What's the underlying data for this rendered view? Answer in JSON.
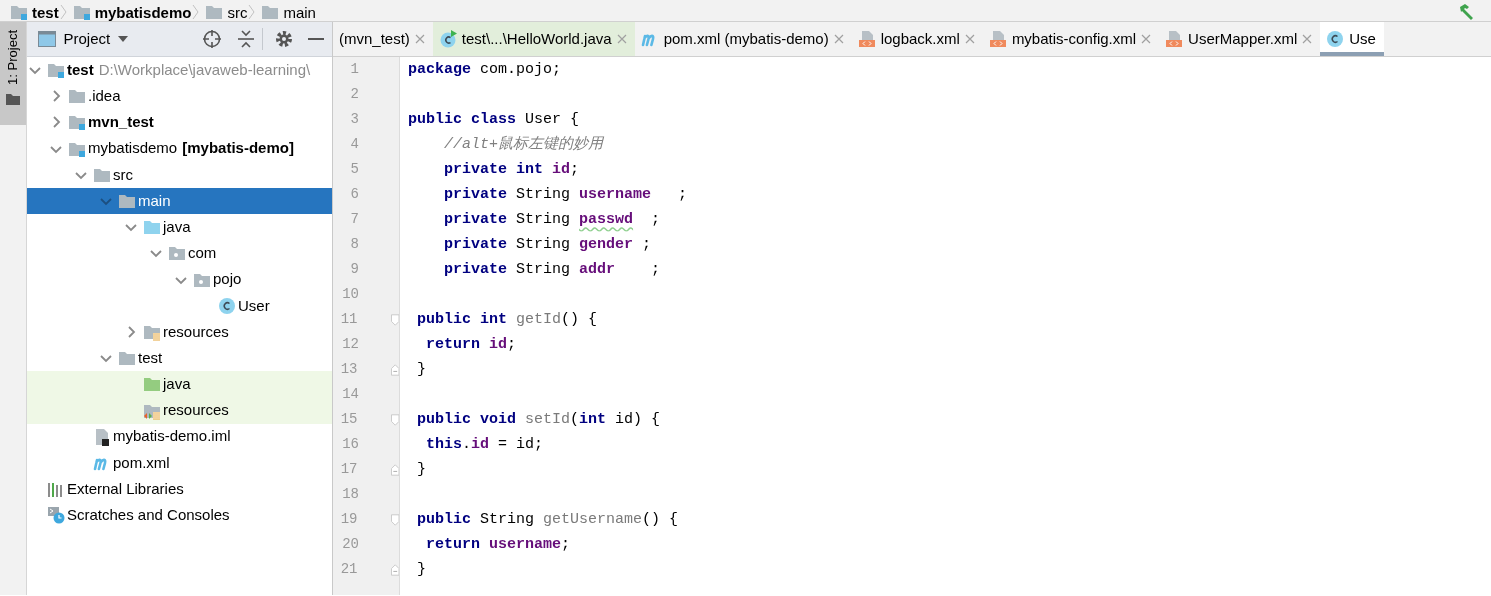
{
  "breadcrumb": [
    {
      "label": "test",
      "kind": "module",
      "bold": true
    },
    {
      "label": "mybatisdemo",
      "kind": "module",
      "bold": true
    },
    {
      "label": "src",
      "kind": "folder",
      "bold": false
    },
    {
      "label": "main",
      "kind": "folder",
      "bold": false
    }
  ],
  "side_tab": {
    "label": "1: Project",
    "selected": true
  },
  "project_panel": {
    "title": "Project"
  },
  "tree": [
    {
      "label": "test",
      "path": "D:\\Workplace\\javaweb-learning\\",
      "kind": "module",
      "bold": true,
      "selected": false,
      "expanded": true,
      "children": [
        {
          "label": ".idea",
          "kind": "folder",
          "bold": false,
          "selected": false,
          "expanded": false
        },
        {
          "label": "mvn_test",
          "kind": "module",
          "bold": true,
          "selected": false,
          "expanded": false
        },
        {
          "label": "mybatisdemo",
          "module_name": "[mybatis-demo]",
          "kind": "module",
          "bold": false,
          "selected": false,
          "expanded": true,
          "children": [
            {
              "label": "src",
              "kind": "folder",
              "bold": false,
              "selected": false,
              "expanded": true,
              "children": [
                {
                  "label": "main",
                  "kind": "folder",
                  "bold": false,
                  "selected": true,
                  "expanded": true,
                  "children": [
                    {
                      "label": "java",
                      "kind": "source",
                      "bold": false,
                      "selected": false,
                      "expanded": true,
                      "children": [
                        {
                          "label": "com",
                          "kind": "package",
                          "bold": false,
                          "selected": false,
                          "expanded": true,
                          "children": [
                            {
                              "label": "pojo",
                              "kind": "package",
                              "bold": false,
                              "selected": false,
                              "expanded": true,
                              "children": [
                                {
                                  "label": "User",
                                  "kind": "class",
                                  "bold": false,
                                  "selected": false
                                }
                              ]
                            }
                          ]
                        }
                      ]
                    },
                    {
                      "label": "resources",
                      "kind": "resources",
                      "bold": false,
                      "selected": false,
                      "expanded": false
                    }
                  ]
                },
                {
                  "label": "test",
                  "kind": "folder",
                  "bold": false,
                  "selected": false,
                  "expanded": true,
                  "children": [
                    {
                      "label": "java",
                      "kind": "test-source",
                      "bold": false,
                      "selected": false
                    },
                    {
                      "label": "resources",
                      "kind": "test-resources",
                      "bold": false,
                      "selected": false
                    }
                  ]
                }
              ]
            },
            {
              "label": "mybatis-demo.iml",
              "kind": "iml",
              "bold": false,
              "selected": false
            },
            {
              "label": "pom.xml",
              "kind": "maven",
              "bold": false,
              "selected": false
            }
          ]
        }
      ]
    },
    {
      "label": "External Libraries",
      "kind": "libraries",
      "bold": false,
      "selected": false
    },
    {
      "label": "Scratches and Consoles",
      "kind": "scratches",
      "bold": false,
      "selected": false
    }
  ],
  "tabs": [
    {
      "label": "(mvn_test)",
      "kind": "plain",
      "selected": false,
      "closable": true
    },
    {
      "label": "test\\...\\HelloWorld.java",
      "kind": "test-class",
      "selected": false,
      "closable": true
    },
    {
      "label": "pom.xml (mybatis-demo)",
      "kind": "maven",
      "selected": false,
      "closable": true
    },
    {
      "label": "logback.xml",
      "kind": "xml",
      "selected": false,
      "closable": true
    },
    {
      "label": "mybatis-config.xml",
      "kind": "xml",
      "selected": false,
      "closable": true
    },
    {
      "label": "UserMapper.xml",
      "kind": "xml",
      "selected": false,
      "closable": true
    },
    {
      "label": "Use",
      "kind": "class",
      "selected": true,
      "closable": false
    }
  ],
  "code": [
    {
      "number": "1",
      "kind": "code",
      "tokens": [
        {
          "text": "package",
          "kind": "keyword"
        },
        {
          "text": " com.pojo;",
          "kind": "plain"
        }
      ]
    },
    {
      "number": "2",
      "kind": "code"
    },
    {
      "number": "3",
      "kind": "code",
      "tokens": [
        {
          "text": "public class",
          "kind": "keyword"
        },
        {
          "text": " User {",
          "kind": "plain"
        }
      ]
    },
    {
      "number": "4",
      "kind": "code",
      "tokens": [
        {
          "text": "    //alt+鼠标左键的妙用",
          "kind": "comment"
        }
      ]
    },
    {
      "number": "5",
      "kind": "code",
      "tokens": [
        {
          "text": "    private int ",
          "kind": "keyword"
        },
        {
          "text": "id",
          "kind": "field"
        },
        {
          "text": ";",
          "kind": "plain"
        }
      ]
    },
    {
      "number": "6",
      "kind": "code",
      "tokens": [
        {
          "text": "    private",
          "kind": "keyword"
        },
        {
          "text": " String ",
          "kind": "plain"
        },
        {
          "text": "username",
          "kind": "field"
        },
        {
          "text": "   ;",
          "kind": "plain"
        }
      ]
    },
    {
      "number": "7",
      "kind": "code",
      "tokens": [
        {
          "text": "    private",
          "kind": "keyword"
        },
        {
          "text": " String ",
          "kind": "plain"
        },
        {
          "text": "passwd",
          "kind": "field-typo"
        },
        {
          "text": "  ;",
          "kind": "plain"
        }
      ]
    },
    {
      "number": "8",
      "kind": "code",
      "tokens": [
        {
          "text": "    private",
          "kind": "keyword"
        },
        {
          "text": " String ",
          "kind": "plain"
        },
        {
          "text": "gender",
          "kind": "field"
        },
        {
          "text": " ;",
          "kind": "plain"
        }
      ]
    },
    {
      "number": "9",
      "kind": "code",
      "tokens": [
        {
          "text": "    private",
          "kind": "keyword"
        },
        {
          "text": " String ",
          "kind": "plain"
        },
        {
          "text": "addr",
          "kind": "field"
        },
        {
          "text": "    ;",
          "kind": "plain"
        }
      ]
    },
    {
      "number": "10",
      "kind": "code"
    },
    {
      "number": "11",
      "kind": "fold-start",
      "tokens": [
        {
          "text": " public int ",
          "kind": "keyword"
        },
        {
          "text": "getId",
          "kind": "method"
        },
        {
          "text": "() {",
          "kind": "plain"
        }
      ]
    },
    {
      "number": "12",
      "kind": "code",
      "tokens": [
        {
          "text": "  return ",
          "kind": "keyword"
        },
        {
          "text": "id",
          "kind": "field"
        },
        {
          "text": ";",
          "kind": "plain"
        }
      ]
    },
    {
      "number": "13",
      "kind": "fold-end",
      "tokens": [
        {
          "text": " }",
          "kind": "plain"
        }
      ]
    },
    {
      "number": "14",
      "kind": "code"
    },
    {
      "number": "15",
      "kind": "fold-start",
      "tokens": [
        {
          "text": " public void ",
          "kind": "keyword"
        },
        {
          "text": "setId",
          "kind": "method"
        },
        {
          "text": "(",
          "kind": "plain"
        },
        {
          "text": "int",
          "kind": "keyword"
        },
        {
          "text": " id) {",
          "kind": "plain"
        }
      ]
    },
    {
      "number": "16",
      "kind": "code",
      "tokens": [
        {
          "text": "  this",
          "kind": "keyword"
        },
        {
          "text": ".",
          "kind": "plain"
        },
        {
          "text": "id",
          "kind": "field"
        },
        {
          "text": " = id;",
          "kind": "plain"
        }
      ]
    },
    {
      "number": "17",
      "kind": "fold-end",
      "tokens": [
        {
          "text": " }",
          "kind": "plain"
        }
      ]
    },
    {
      "number": "18",
      "kind": "code"
    },
    {
      "number": "19",
      "kind": "fold-start",
      "tokens": [
        {
          "text": " public",
          "kind": "keyword"
        },
        {
          "text": " String ",
          "kind": "plain"
        },
        {
          "text": "getUsername",
          "kind": "method"
        },
        {
          "text": "() {",
          "kind": "plain"
        }
      ]
    },
    {
      "number": "20",
      "kind": "code",
      "tokens": [
        {
          "text": "  return ",
          "kind": "keyword"
        },
        {
          "text": "username",
          "kind": "field"
        },
        {
          "text": ";",
          "kind": "plain"
        }
      ]
    },
    {
      "number": "21",
      "kind": "fold-end",
      "tokens": [
        {
          "text": " }",
          "kind": "plain"
        }
      ]
    }
  ]
}
